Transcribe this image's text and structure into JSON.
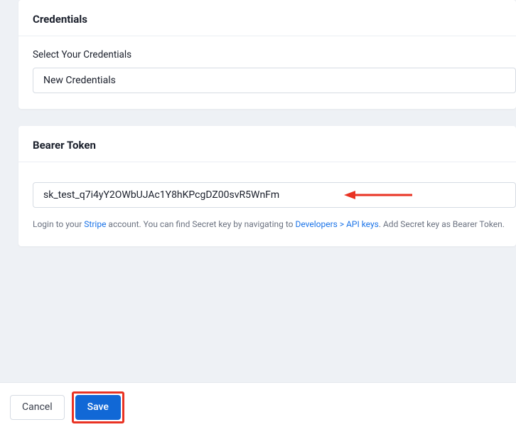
{
  "credentials": {
    "title": "Credentials",
    "field_label": "Select Your Credentials",
    "dropdown_value": "New Credentials"
  },
  "bearer": {
    "title": "Bearer Token",
    "input_value": "sk_test_q7i4yY2OWbUJAc1Y8hKPcgDZ00svR5WnFm",
    "helper_prefix": "Login to your ",
    "helper_link1": "Stripe",
    "helper_mid": " account. You can find Secret key by navigating to ",
    "helper_link2": "Developers > API keys",
    "helper_suffix": ". Add Secret key as Bearer Token."
  },
  "footer": {
    "cancel_label": "Cancel",
    "save_label": "Save"
  },
  "colors": {
    "accent": "#1168d6",
    "highlight": "#e93323"
  }
}
